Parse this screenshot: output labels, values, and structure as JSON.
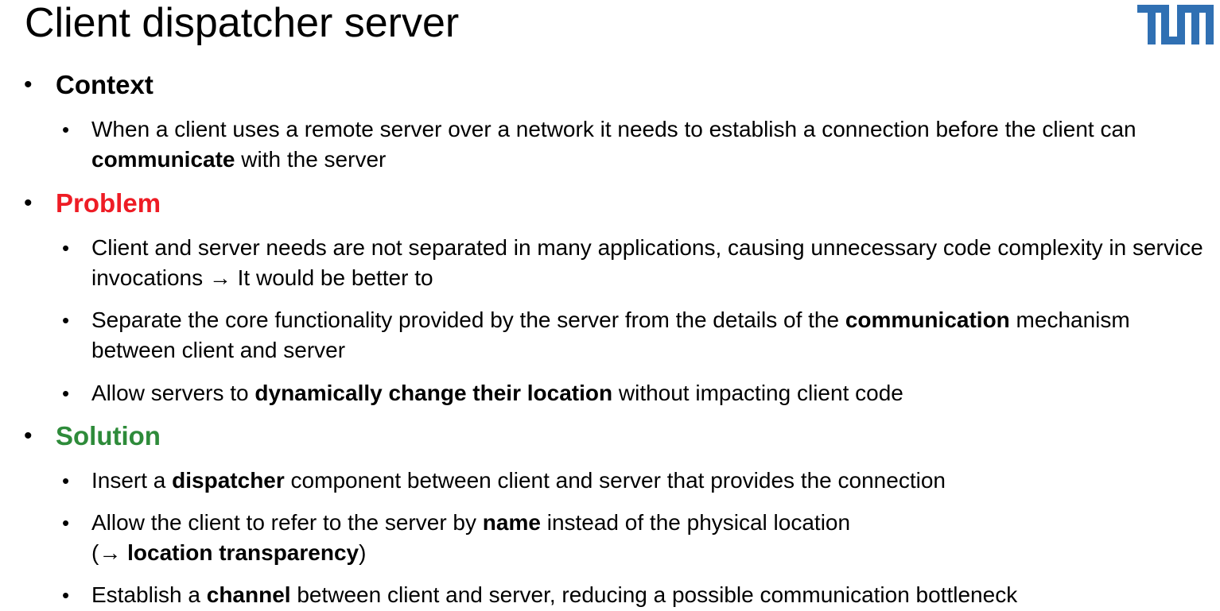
{
  "slide": {
    "title": "Client dispatcher server",
    "logo_text": "TUM",
    "accent_color": "#3070b3",
    "problem_color": "#ee1c25",
    "solution_color": "#2e8b3a"
  },
  "sections": {
    "context": {
      "heading": "Context",
      "items": [
        {
          "a": "When a client uses a remote server over a network it needs to establish a connection before the client can ",
          "b": "communicate",
          "c": " with the server"
        }
      ]
    },
    "problem": {
      "heading": "Problem",
      "items": [
        {
          "a": "Client and server needs are not separated in many applications, causing unnecessary code complexity in service invocations → It would be better to"
        },
        {
          "a": "Separate the core functionality provided by the server from the details of the ",
          "b": "communication",
          "c": " mechanism between client and server"
        },
        {
          "a": "Allow servers to ",
          "b": "dynamically change their location",
          "c": " without impacting client code"
        }
      ]
    },
    "solution": {
      "heading": "Solution",
      "items": [
        {
          "a": "Insert a ",
          "b": "dispatcher",
          "c": " component between client and server that provides the connection"
        },
        {
          "a": "Allow the client to refer to the server by ",
          "b": "name",
          "c": " instead of the physical location",
          "d": "(→ ",
          "e": "location transparency",
          "f": ")"
        },
        {
          "a": "Establish a ",
          "b": "channel",
          "c": " between client and server, reducing a possible communication bottleneck"
        }
      ]
    }
  }
}
